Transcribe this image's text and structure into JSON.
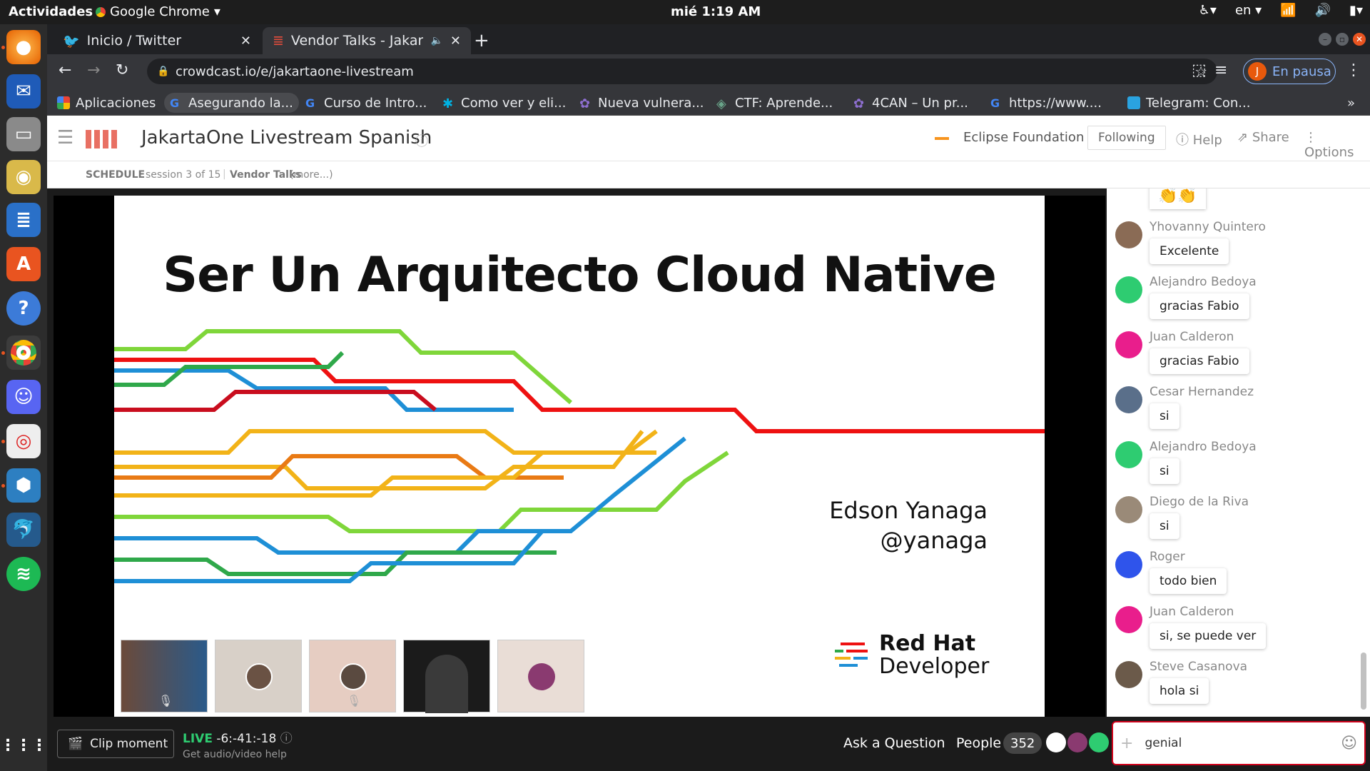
{
  "system": {
    "activities": "Actividades",
    "app_name": "Google Chrome",
    "clock": "mié  1:19 AM",
    "lang": "en",
    "icons": [
      "accessibility-icon",
      "wifi-icon",
      "volume-icon",
      "battery-icon"
    ]
  },
  "tabs": [
    {
      "label": "Inicio / Twitter",
      "icon": "twitter-icon",
      "active": false
    },
    {
      "label": "Vendor Talks - Jakart",
      "icon": "crowdcast-icon",
      "active": true
    }
  ],
  "toolbar": {
    "url": "crowdcast.io/e/jakartaone-livestream",
    "paused_label": "En pausa",
    "profile_initial": "J"
  },
  "bookmarks": [
    {
      "label": "Aplicaciones",
      "color": "#ea4335"
    },
    {
      "label": "Asegurando la...",
      "color": "#4285f4"
    },
    {
      "label": "Curso de Intro...",
      "color": "#4285f4"
    },
    {
      "label": "Como ver y eli...",
      "color": "#00b2e3"
    },
    {
      "label": "Nueva vulnera...",
      "color": "#8e6fd1"
    },
    {
      "label": "CTF: Aprende...",
      "color": "#6aa58a"
    },
    {
      "label": "4CAN – Un pr...",
      "color": "#8e6fd1"
    },
    {
      "label": "https://www....",
      "color": "#4285f4"
    },
    {
      "label": "Telegram: Con...",
      "color": "#2aa3e0"
    }
  ],
  "header": {
    "title": "JakartaOne Livestream Spanish",
    "org": "Eclipse Foundation",
    "following": "Following",
    "help": "Help",
    "share": "Share",
    "options": "Options"
  },
  "schedule": {
    "label": "SCHEDULE",
    "session": "session 3 of 15",
    "name": "Vendor Talks",
    "more": "(more...)"
  },
  "slide": {
    "title": "Ser Un Arquitecto Cloud Native",
    "speaker": "Edson Yanaga",
    "handle": "@yanaga",
    "brand_line1": "Red Hat",
    "brand_line2": "Developer"
  },
  "chat": [
    {
      "name": "Yhovanny Quintero",
      "text": "Excelente",
      "avatar": "#8a6b55"
    },
    {
      "name": "Alejandro Bedoya",
      "text": "gracias Fabio",
      "avatar": "#2ecc71"
    },
    {
      "name": "Juan Calderon",
      "text": "gracias Fabio",
      "avatar": "#e91e8c"
    },
    {
      "name": "Cesar Hernandez",
      "text": "si",
      "avatar": "#5a6f8a"
    },
    {
      "name": "Alejandro Bedoya",
      "text": "si",
      "avatar": "#2ecc71"
    },
    {
      "name": "Diego de la Riva",
      "text": "si",
      "avatar": "#9a8a78"
    },
    {
      "name": "Roger",
      "text": "todo bien",
      "avatar": "#2f54eb"
    },
    {
      "name": "Juan Calderon",
      "text": "si, se puede ver",
      "avatar": "#e91e8c"
    },
    {
      "name": "Steve Casanova",
      "text": "hola si",
      "avatar": "#6b5a4a"
    }
  ],
  "bottom": {
    "clip": "Clip moment",
    "live": "LIVE",
    "timer": "-6:-41:-18",
    "help": "Get audio/video help",
    "ask": "Ask a Question",
    "people": "People",
    "count": "352",
    "input_value": "genial"
  }
}
